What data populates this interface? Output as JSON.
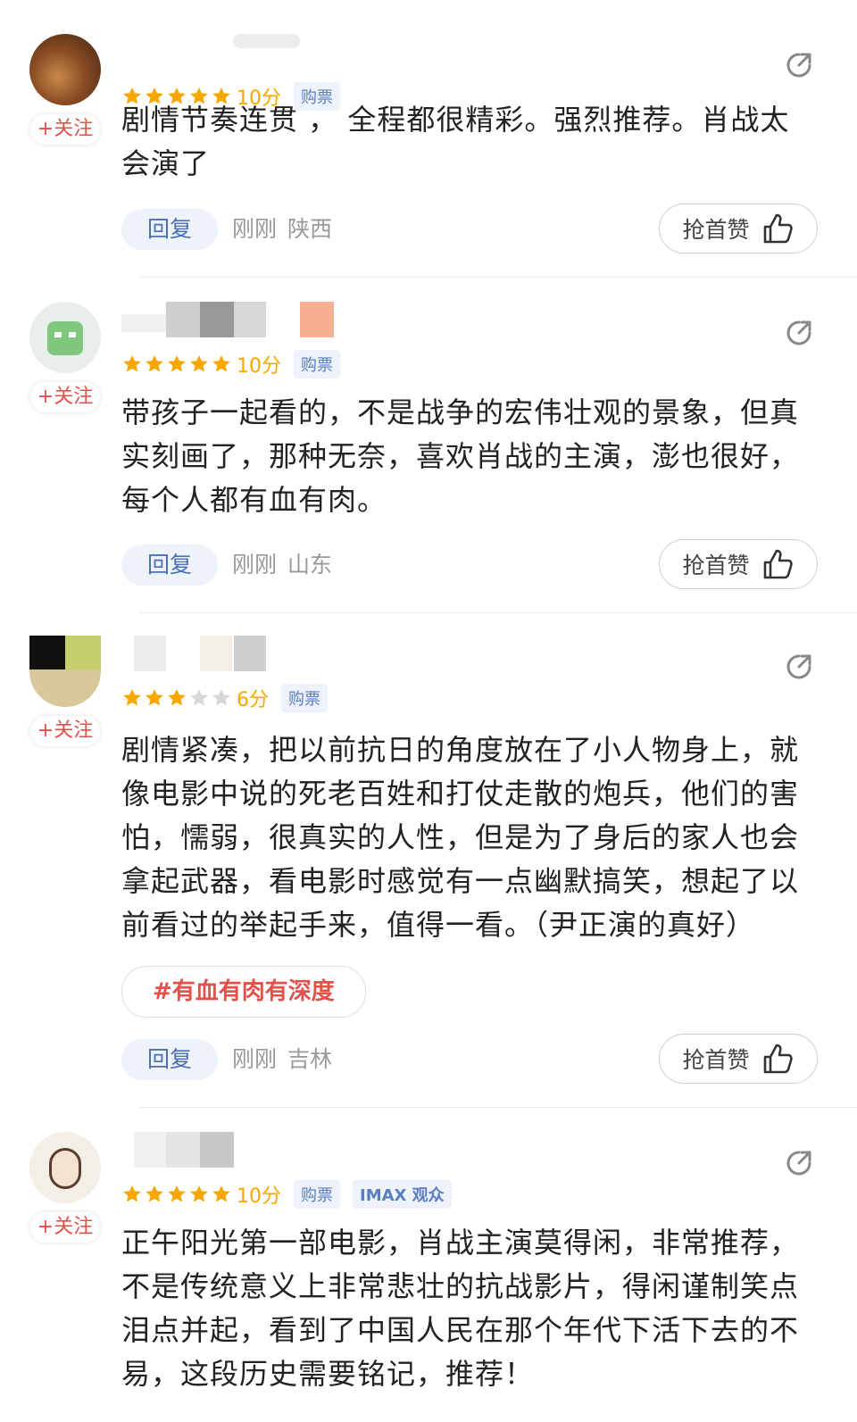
{
  "follow_label": "+关注",
  "ticket_label": "购票",
  "reply_label": "回复",
  "like_label": "抢首赞",
  "accent_color": "#e2504a",
  "star_color": "#f7a700",
  "comments": [
    {
      "stars": 5,
      "score": "10分",
      "time": "刚刚",
      "location": "陕西",
      "text": "剧情节奏连贯 ， 全程都很精彩。强烈推荐。肖战太会演了"
    },
    {
      "stars": 5,
      "score": "10分",
      "time": "刚刚",
      "location": "山东",
      "text": "带孩子一起看的，不是战争的宏伟壮观的景象，但真实刻画了，那种无奈，喜欢肖战的主演，澎也很好，每个人都有血有肉。"
    },
    {
      "stars": 3,
      "score": "6分",
      "time": "刚刚",
      "location": "吉林",
      "text": "剧情紧凑，把以前抗日的角度放在了小人物身上，就像电影中说的死老百姓和打仗走散的炮兵，他们的害怕，懦弱，很真实的人性，但是为了身后的家人也会拿起武器，看电影时感觉有一点幽默搞笑，想起了以前看过的举起手来，值得一看。（尹正演的真好）",
      "topic": "#有血有肉有深度"
    },
    {
      "stars": 5,
      "score": "10分",
      "extra_tag": "IMAX 观众",
      "text": "正午阳光第一部电影，肖战主演莫得闲，非常推荐，不是传统意义上非常悲壮的抗战影片，得闲谨制笑点泪点并起，看到了中国人民在那个年代下活下去的不易，这段历史需要铭记，推荐！"
    }
  ]
}
